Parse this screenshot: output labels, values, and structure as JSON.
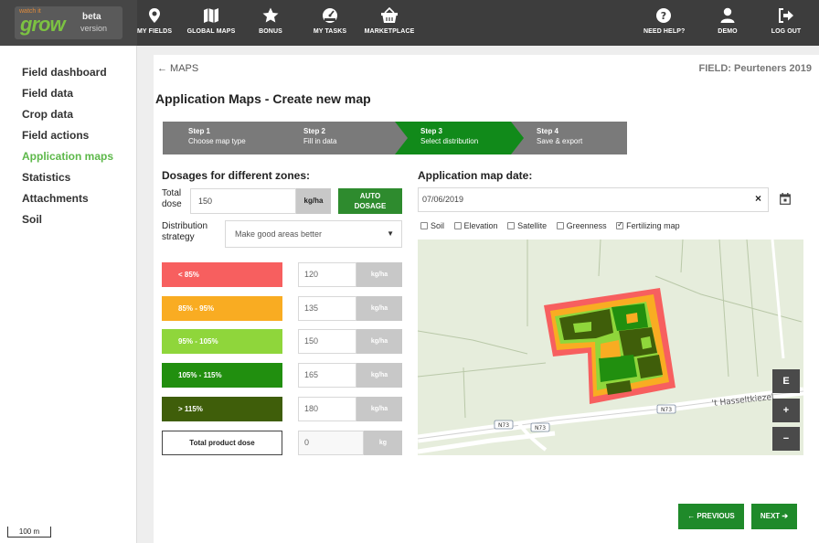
{
  "brand": {
    "small": "watch it",
    "name": "grow",
    "beta": "beta",
    "version": "version"
  },
  "nav": {
    "my_fields": "MY FIELDS",
    "global_maps": "GLOBAL MAPS",
    "bonus": "BONUS",
    "my_tasks": "MY TASKS",
    "marketplace": "MARKETPLACE",
    "need_help": "NEED HELP?",
    "demo": "DEMO",
    "log_out": "LOG OUT"
  },
  "sidebar": {
    "items": [
      {
        "label": "Field dashboard"
      },
      {
        "label": "Field data"
      },
      {
        "label": "Crop data"
      },
      {
        "label": "Field actions"
      },
      {
        "label": "Application maps"
      },
      {
        "label": "Statistics"
      },
      {
        "label": "Attachments"
      },
      {
        "label": "Soil"
      }
    ],
    "scale": "100 m"
  },
  "header": {
    "back": "← MAPS",
    "field": "FIELD: Peurteners 2019",
    "title": "Application Maps - Create new map"
  },
  "steps": [
    {
      "num": "Step 1",
      "desc": "Choose map type"
    },
    {
      "num": "Step 2",
      "desc": "Fill in data"
    },
    {
      "num": "Step 3",
      "desc": "Select distribution"
    },
    {
      "num": "Step 4",
      "desc": "Save & export"
    }
  ],
  "dosages": {
    "title": "Dosages for different zones:",
    "total_label_1": "Total",
    "total_label_2": "dose",
    "total_value": "150",
    "total_unit": "kg/ha",
    "auto_1": "AUTO",
    "auto_2": "DOSAGE",
    "strategy_label_1": "Distribution",
    "strategy_label_2": "strategy",
    "strategy_value": "Make good areas better",
    "zones": [
      {
        "label": "< 85%",
        "value": "120",
        "unit": "kg/ha",
        "color": "#f75f5f"
      },
      {
        "label": "85% - 95%",
        "value": "135",
        "unit": "kg/ha",
        "color": "#f9ac22"
      },
      {
        "label": "95% - 105%",
        "value": "150",
        "unit": "kg/ha",
        "color": "#8fd63b"
      },
      {
        "label": "105% - 115%",
        "value": "165",
        "unit": "kg/ha",
        "color": "#218f0f"
      },
      {
        "label": "> 115%",
        "value": "180",
        "unit": "kg/ha",
        "color": "#3f5e0a"
      }
    ],
    "total_product_label": "Total product dose",
    "total_product_value": "0",
    "total_product_unit": "kg"
  },
  "map_date": {
    "title": "Application map date:",
    "value": "07/06/2019",
    "clear": "×"
  },
  "layers": [
    {
      "label": "Soil",
      "checked": false
    },
    {
      "label": "Elevation",
      "checked": false
    },
    {
      "label": "Satellite",
      "checked": false
    },
    {
      "label": "Greenness",
      "checked": false
    },
    {
      "label": "Fertilizing map",
      "checked": true
    }
  ],
  "map": {
    "road_label": "'t Hasseltkiezel",
    "road_shield": "N73",
    "btn_e": "E",
    "btn_plus": "+",
    "btn_minus": "−"
  },
  "footer": {
    "previous": "← PREVIOUS",
    "next": "NEXT ➔"
  },
  "colors": {
    "green": "#118a1a",
    "active_menu": "#5db84a",
    "topbar": "#3d3d3d"
  }
}
